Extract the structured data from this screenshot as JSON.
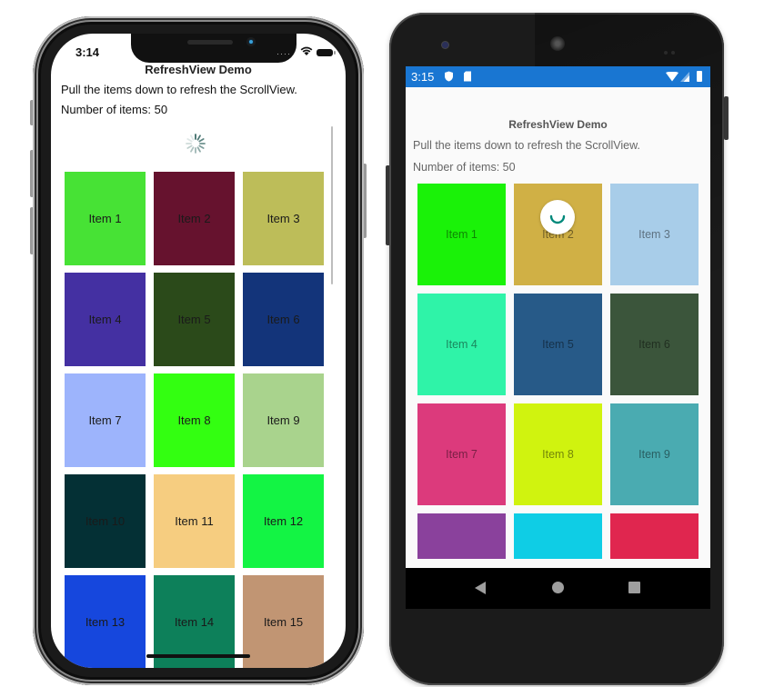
{
  "ios": {
    "status": {
      "time": "3:14"
    },
    "title": "RefreshView Demo",
    "instructions": "Pull the items down to refresh the ScrollView.",
    "count_label": "Number of items: 50",
    "items": [
      {
        "label": "Item 1",
        "color": "#47e235"
      },
      {
        "label": "Item 2",
        "color": "#66122e"
      },
      {
        "label": "Item 3",
        "color": "#bdbd59"
      },
      {
        "label": "Item 4",
        "color": "#4430a2"
      },
      {
        "label": "Item 5",
        "color": "#2b4a1a"
      },
      {
        "label": "Item 6",
        "color": "#13347a"
      },
      {
        "label": "Item 7",
        "color": "#9db4fc"
      },
      {
        "label": "Item 8",
        "color": "#33ff11"
      },
      {
        "label": "Item 9",
        "color": "#a9d38d"
      },
      {
        "label": "Item 10",
        "color": "#043035"
      },
      {
        "label": "Item 11",
        "color": "#f6cd80"
      },
      {
        "label": "Item 12",
        "color": "#13f444"
      },
      {
        "label": "Item 13",
        "color": "#1647dd"
      },
      {
        "label": "Item 14",
        "color": "#0d805a"
      },
      {
        "label": "Item 15",
        "color": "#c19573"
      }
    ]
  },
  "android": {
    "status": {
      "time": "3:15"
    },
    "title": "RefreshView Demo",
    "instructions": "Pull the items down to refresh the ScrollView.",
    "count_label": "Number of items: 50",
    "accent_color": "#1976d2",
    "spinner_color": "#00897b",
    "items": [
      {
        "label": "Item 1",
        "color": "#1af208"
      },
      {
        "label": "Item 2",
        "color": "#d0b045"
      },
      {
        "label": "Item 3",
        "color": "#a8cde9"
      },
      {
        "label": "Item 4",
        "color": "#2ff3a8"
      },
      {
        "label": "Item 5",
        "color": "#275a88"
      },
      {
        "label": "Item 6",
        "color": "#3b553b"
      },
      {
        "label": "Item 7",
        "color": "#dc3a7c"
      },
      {
        "label": "Item 8",
        "color": "#d0f30f"
      },
      {
        "label": "Item 9",
        "color": "#4aabb1"
      },
      {
        "label": "",
        "color": "#8a419c"
      },
      {
        "label": "",
        "color": "#0fcde5"
      },
      {
        "label": "",
        "color": "#e0264f"
      }
    ]
  }
}
